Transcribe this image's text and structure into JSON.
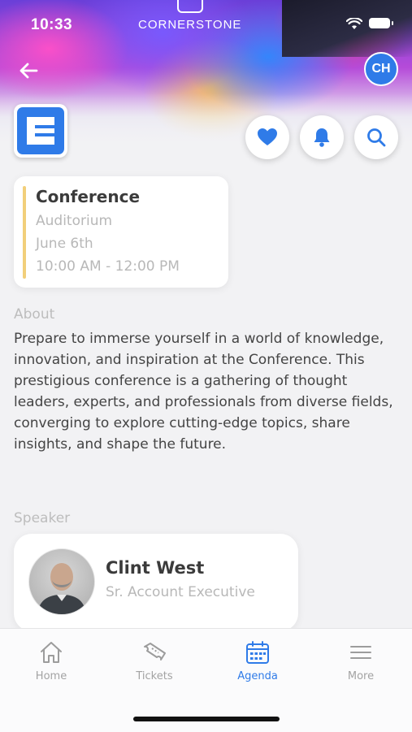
{
  "status_bar": {
    "time": "10:33"
  },
  "header": {
    "brand": "CORNERSTONE",
    "avatar_initials": "CH"
  },
  "session": {
    "title": "Conference",
    "location": "Auditorium",
    "date": "June 6th",
    "time_range": "10:00 AM - 12:00 PM"
  },
  "about": {
    "label": "About",
    "text": "Prepare to immerse yourself in a world of knowledge, innovation, and inspiration at the Conference. This prestigious conference is a gathering of thought leaders, experts, and professionals from diverse fields, converging to explore cutting-edge topics, share insights, and shape the future."
  },
  "speaker": {
    "label": "Speaker",
    "name": "Clint West",
    "role": "Sr. Account Executive"
  },
  "tabbar": {
    "items": [
      {
        "label": "Home",
        "icon": "home-icon",
        "active": false
      },
      {
        "label": "Tickets",
        "icon": "ticket-icon",
        "active": false
      },
      {
        "label": "Agenda",
        "icon": "calendar-icon",
        "active": true
      },
      {
        "label": "More",
        "icon": "menu-icon",
        "active": false
      }
    ]
  },
  "colors": {
    "accent": "#2f7be8",
    "card_accent": "#f2cf7a",
    "muted_text": "#b8b8b8"
  }
}
